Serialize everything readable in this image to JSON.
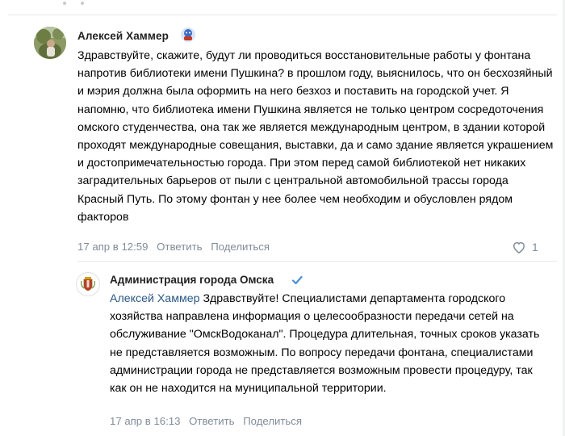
{
  "comment": {
    "author": "Алексей Хаммер",
    "badge_icon": "emoji-avatar-badge-icon",
    "text": "Здравствуйте, скажите, будут ли проводиться восстановительные работы у фонтана напротив библиотеки имени Пушкина? в прошлом году, выяснилось, что он бесхозяйный и мэрия должна была оформить на него безхоз и поставить на городской учет. Я напомню, что библиотека имени Пушкина является не только центром сосредоточения омского студенчества, она так же является международным центром, в здании которой проходят международные совещания, выставки, да и само здание является украшением и достопримечательностью города. При этом перед самой библиотекой нет никаких заградительных барьеров от пыли с центральной автомобильной трассы города Красный Путь. По этому фонтан у нее более чем необходим и обусловлен рядом факторов",
    "date": "17 апр в 12:59",
    "reply_label": "Ответить",
    "share_label": "Поделиться",
    "likes": "1",
    "like_icon": "heart-icon"
  },
  "reply": {
    "author": "Администрация города Омска",
    "verified_icon": "verified-check-icon",
    "mention": "Алексей Хаммер",
    "text": " Здравствуйте! Специалистами департамента городского хозяйства направлена информация о целесообразности передачи сетей на обслуживание \"ОмскВодоканал\". Процедура длительная, точных сроков указать не представляется возможным. По вопросу передачи фонтана, специалистами администрации города не представляется возможным провести процедуру, так как он не находится на муниципальной территории.",
    "date": "17 апр в 16:13",
    "reply_label": "Ответить",
    "share_label": "Поделиться"
  },
  "colors": {
    "link": "#2a5885",
    "meta": "#818c99",
    "verified": "#4a8fd8"
  }
}
